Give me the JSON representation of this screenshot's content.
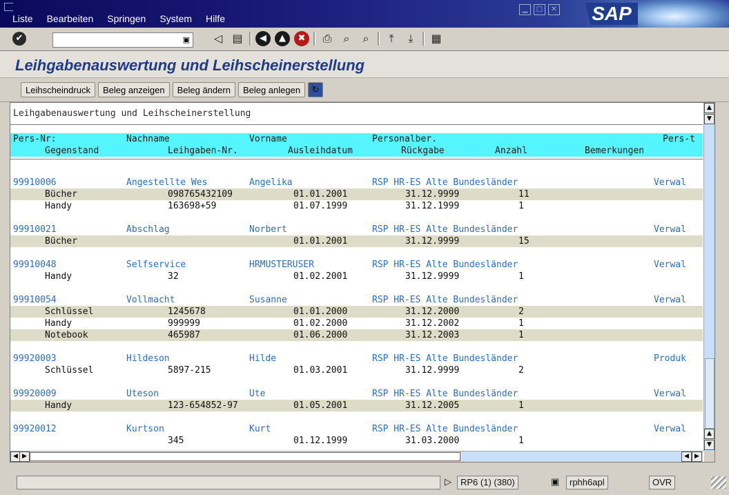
{
  "menu": [
    "Liste",
    "Bearbeiten",
    "Springen",
    "System",
    "Hilfe"
  ],
  "window_buttons": [
    "minimize-icon",
    "maximize-icon",
    "close-icon"
  ],
  "logo": "SAP",
  "toolbar": {
    "command_value": "",
    "icons": [
      "back-icon",
      "save-icon",
      "green-back-icon",
      "exit-icon",
      "cancel-icon",
      "print-icon",
      "find-icon",
      "find-next-icon",
      "first-page-icon",
      "last-page-icon",
      "layout-icon"
    ]
  },
  "screen_title": "Leihgabenauswertung und Leihscheinerstellung",
  "app_toolbar": {
    "buttons": [
      "Leihscheindruck",
      "Beleg anzeigen",
      "Beleg ändern",
      "Beleg anlegen"
    ]
  },
  "list": {
    "heading": "Leihgabenauswertung und Leihscheinerstellung",
    "header1": [
      "Pers-Nr:",
      "Nachname",
      "Vorname",
      "Personalber.",
      "Pers-t"
    ],
    "header2": [
      "Gegenstand",
      "Leihgaben-Nr.",
      "Ausleihdatum",
      "Rückgabe",
      "Anzahl",
      "Bemerkungen"
    ],
    "groups": [
      {
        "persnr": "99910006",
        "nachname": "Angestellte Wes",
        "vorname": "Angelika",
        "personalber": "RSP HR-ES Alte Bundesländer",
        "perst": "Verwal",
        "items": [
          {
            "gegenstand": "Bücher",
            "nr": "098765432109",
            "ausleih": "01.01.2001",
            "rueck": "31.12.9999",
            "anzahl": "11"
          },
          {
            "gegenstand": "Handy",
            "nr": "163698+59",
            "ausleih": "01.07.1999",
            "rueck": "31.12.1999",
            "anzahl": "1"
          }
        ]
      },
      {
        "persnr": "99910021",
        "nachname": "Abschlag",
        "vorname": "Norbert",
        "personalber": "RSP HR-ES Alte Bundesländer",
        "perst": "Verwal",
        "items": [
          {
            "gegenstand": "Bücher",
            "nr": "",
            "ausleih": "01.01.2001",
            "rueck": "31.12.9999",
            "anzahl": "15"
          }
        ]
      },
      {
        "persnr": "99910048",
        "nachname": "Selfservice",
        "vorname": "HRMUSTERUSER",
        "personalber": "RSP HR-ES Alte Bundesländer",
        "perst": "Verwal",
        "items": [
          {
            "gegenstand": "Handy",
            "nr": "32",
            "ausleih": "01.02.2001",
            "rueck": "31.12.9999",
            "anzahl": "1"
          }
        ]
      },
      {
        "persnr": "99910054",
        "nachname": "Vollmacht",
        "vorname": "Susanne",
        "personalber": "RSP HR-ES Alte Bundesländer",
        "perst": "Verwal",
        "items": [
          {
            "gegenstand": "Schlüssel",
            "nr": "1245678",
            "ausleih": "01.01.2000",
            "rueck": "31.12.2000",
            "anzahl": "2"
          },
          {
            "gegenstand": "Handy",
            "nr": "999999",
            "ausleih": "01.02.2000",
            "rueck": "31.12.2002",
            "anzahl": "1"
          },
          {
            "gegenstand": "Notebook",
            "nr": "465987",
            "ausleih": "01.06.2000",
            "rueck": "31.12.2003",
            "anzahl": "1"
          }
        ]
      },
      {
        "persnr": "99920003",
        "nachname": "Hildeson",
        "vorname": "Hilde",
        "personalber": "RSP HR-ES Alte Bundesländer",
        "perst": "Produk",
        "items": [
          {
            "gegenstand": "Schlüssel",
            "nr": "5897-215",
            "ausleih": "01.03.2001",
            "rueck": "31.12.9999",
            "anzahl": "2"
          }
        ]
      },
      {
        "persnr": "99920009",
        "nachname": "Uteson",
        "vorname": "Ute",
        "personalber": "RSP HR-ES Alte Bundesländer",
        "perst": "Verwal",
        "items": [
          {
            "gegenstand": "Handy",
            "nr": "123-654852-97",
            "ausleih": "01.05.2001",
            "rueck": "31.12.2005",
            "anzahl": "1"
          }
        ]
      },
      {
        "persnr": "99920012",
        "nachname": "Kurtson",
        "vorname": "Kurt",
        "personalber": "RSP HR-ES Alte Bundesländer",
        "perst": "Verwal",
        "items": [
          {
            "gegenstand": "",
            "nr": "345",
            "ausleih": "01.12.1999",
            "rueck": "31.03.2000",
            "anzahl": "1"
          }
        ]
      }
    ]
  },
  "status": {
    "system": "RP6 (1) (380)",
    "server": "rphh6apl",
    "mode": "OVR"
  }
}
